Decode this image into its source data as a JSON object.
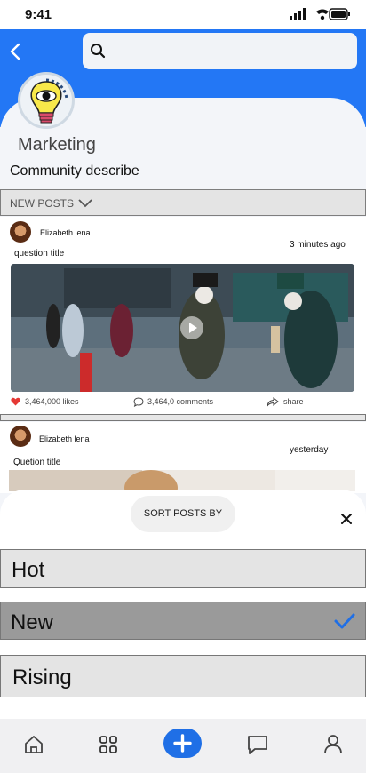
{
  "status": {
    "time": "9:41"
  },
  "search": {
    "placeholder": ""
  },
  "community": {
    "name": "Marketing",
    "description": "Community describe"
  },
  "feed": {
    "filter_label": "NEW POSTS",
    "posts": [
      {
        "author": "Elizabeth lena",
        "time": "3 minutes ago",
        "title": "question title",
        "likes": "3,464,000 likes",
        "comments": "3,464,0 comments",
        "share": "share"
      },
      {
        "author": "Elizabeth lena",
        "time": "yesterday",
        "title": "Quetion title"
      }
    ]
  },
  "sort_sheet": {
    "title": "SORT POSTS BY",
    "options": [
      {
        "label": "Hot",
        "selected": false
      },
      {
        "label": "New",
        "selected": true
      },
      {
        "label": "Rising",
        "selected": false
      }
    ]
  },
  "colors": {
    "accent": "#2377f5",
    "selected_bg": "#9a9a9a",
    "heart": "#e53935"
  },
  "bottom_nav": [
    "home-icon",
    "grid-icon",
    "plus-icon",
    "chat-icon",
    "profile-icon"
  ]
}
